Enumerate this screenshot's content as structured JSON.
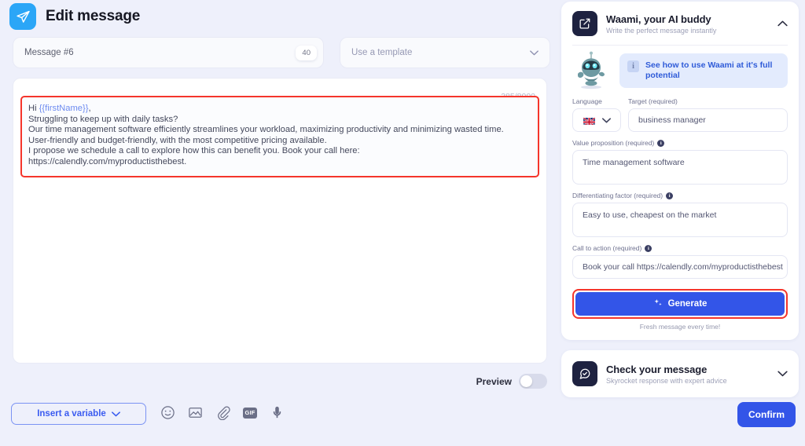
{
  "header": {
    "title": "Edit message",
    "app_icon": "send-plane-icon",
    "accent": "#2ba6f7"
  },
  "top_fields": {
    "message_name": "Message #6",
    "message_name_counter": "40",
    "template_placeholder": "Use a template",
    "template_chevron": "chevron-down-icon"
  },
  "editor": {
    "char_count": "385/8000",
    "highlight_color": "#f5352b",
    "lines": [
      {
        "prefix": "Hi ",
        "token": "{{firstName}}",
        "suffix": ","
      },
      {
        "prefix": "Struggling to keep up with daily tasks?",
        "token": "",
        "suffix": ""
      },
      {
        "prefix": "Our time management software efficiently streamlines your workload, maximizing productivity and minimizing wasted time.",
        "token": "",
        "suffix": ""
      },
      {
        "prefix": "User-friendly and budget-friendly, with the most competitive pricing available.",
        "token": "",
        "suffix": ""
      },
      {
        "prefix": "I propose we schedule a call to explore how this can benefit you. Book your call here:",
        "token": "",
        "suffix": ""
      },
      {
        "prefix": "https://calendly.com/myproductisthebest.",
        "token": "",
        "suffix": ""
      }
    ]
  },
  "preview": {
    "label": "Preview",
    "enabled": false
  },
  "toolbar": {
    "insert_variable_label": "Insert a variable",
    "insert_variable_chevron": "chevron-down-icon",
    "icons": [
      "emoji-icon",
      "image-icon",
      "attachment-icon",
      "gif-icon",
      "microphone-icon"
    ],
    "gif_label": "GIF",
    "confirm_label": "Confirm"
  },
  "waami": {
    "title": "Waami, your AI buddy",
    "subtitle": "Write the perfect message instantly",
    "icon": "edit-square-icon",
    "collapse_chevron": "chevron-up-icon",
    "mascot": "robot-mascot-icon",
    "tip_icon": "info-icon",
    "tip_text": "See how to use Waami at it's full potential",
    "language_label": "Language",
    "language_flag": "uk-flag-icon",
    "target_label": "Target (required)",
    "target_value": "business manager",
    "value_prop_label": "Value proposition (required)",
    "value_prop_info": "info-icon",
    "value_prop_value": "Time management software",
    "diff_label": "Differentiating factor (required)",
    "diff_info": "info-icon",
    "diff_value": "Easy to use, cheapest on the market",
    "cta_label": "Call to action (required)",
    "cta_info": "info-icon",
    "cta_value": "Book your call https://calendly.com/myproductisthebest",
    "generate_label": "Generate",
    "generate_icon": "sparkle-icon",
    "generate_note": "Fresh message every time!",
    "generate_color": "#3355e8"
  },
  "check_message": {
    "title": "Check your message",
    "subtitle": "Skyrocket response with expert advice",
    "icon": "chat-check-icon",
    "expand_chevron": "chevron-down-icon"
  }
}
